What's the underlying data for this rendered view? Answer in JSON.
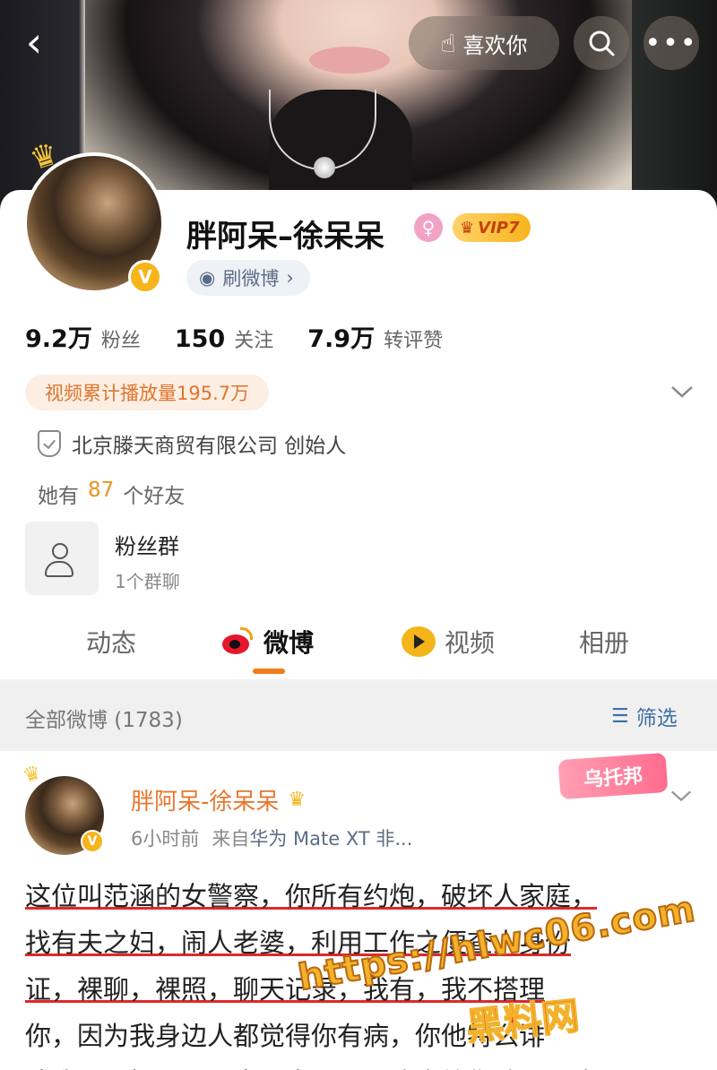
{
  "header": {
    "back_icon": "back-chevron-icon",
    "like_label": "喜欢你",
    "like_icon": "hand-heart-icon",
    "search_icon": "search-icon",
    "more_icon": "more-dots-icon"
  },
  "profile": {
    "name": "胖阿呆–徐呆呆",
    "gender_icon": "female-icon",
    "vip_label": "VIP7",
    "verified_badge": "V",
    "brush_label": "刷微博",
    "stats": [
      {
        "value": "9.2万",
        "label": "粉丝"
      },
      {
        "value": "150",
        "label": "关注"
      },
      {
        "value": "7.9万",
        "label": "转评赞"
      }
    ],
    "video_views": "视频累计播放量195.7万",
    "company": "北京滕天商贸有限公司 创始人",
    "friends_prefix": "她有",
    "friends_count": "87",
    "friends_suffix": "个好友",
    "fan_group": {
      "title": "粉丝群",
      "subtitle": "1个群聊"
    }
  },
  "tabs": [
    {
      "label": "动态",
      "active": false
    },
    {
      "label": "微博",
      "active": true
    },
    {
      "label": "视频",
      "active": false
    },
    {
      "label": "相册",
      "active": false
    }
  ],
  "filter": {
    "label": "全部微博 (1783)",
    "button": "筛选"
  },
  "post": {
    "author": "胖阿呆-徐呆呆",
    "time": "6小时前",
    "source_prefix": "来自",
    "source": "华为 Mate XT 非...",
    "tag": "乌托邦",
    "text_lines": [
      "这位叫范涵的女警察，你所有约炮，破坏人家庭，",
      "找有夫之妇，闹人老婆，利用工作之便查人身份",
      "证，裸聊，裸照，聊天记录，我有，我不搭理",
      "你，因为我身边人都觉得你有病，你他特么诽",
      "谤我啊，妈了逼没事骂人父母，我真给你脸了，这"
    ]
  },
  "watermark": {
    "url": "https://hlwc06.com",
    "name": "黑料网"
  },
  "colors": {
    "accent": "#f07c1b",
    "author_orange": "#e8772e",
    "link_blue": "#3f6fa8",
    "vip_gold": "#f7b41c",
    "underline_red": "#e02828"
  }
}
